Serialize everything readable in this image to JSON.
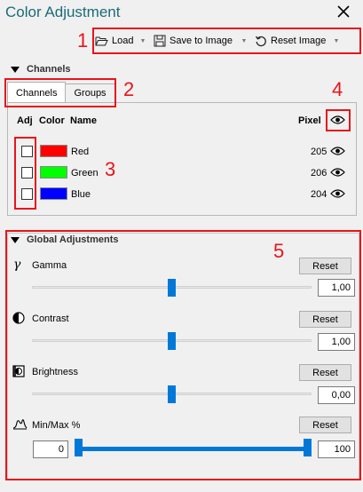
{
  "panel": {
    "title": "Color Adjustment"
  },
  "toolbar": {
    "load_label": "Load",
    "save_label": "Save to Image",
    "reset_label": "Reset Image"
  },
  "channels_section": {
    "title": "Channels"
  },
  "tabs": [
    {
      "label": "Channels"
    },
    {
      "label": "Groups"
    }
  ],
  "channels_table": {
    "headers": {
      "adj": "Adj",
      "color": "Color",
      "name": "Name",
      "pixel": "Pixel"
    },
    "rows": [
      {
        "name": "Red",
        "color": "#ff0000",
        "pixel": "205"
      },
      {
        "name": "Green",
        "color": "#00ff00",
        "pixel": "206"
      },
      {
        "name": "Blue",
        "color": "#0000ff",
        "pixel": "204"
      }
    ]
  },
  "global_section": {
    "title": "Global Adjustments",
    "gamma": {
      "label": "Gamma",
      "reset": "Reset",
      "value": "1,00"
    },
    "contrast": {
      "label": "Contrast",
      "reset": "Reset",
      "value": "1,00"
    },
    "brightness": {
      "label": "Brightness",
      "reset": "Reset",
      "value": "0,00"
    },
    "minmax": {
      "label": "Min/Max %",
      "reset": "Reset",
      "min": "0",
      "max": "100"
    }
  },
  "annotations": {
    "n1": "1",
    "n2": "2",
    "n3": "3",
    "n4": "4",
    "n5": "5"
  },
  "colors": {
    "accent": "#0078d7",
    "title": "#1a6b79",
    "annotation": "#e8141b"
  }
}
